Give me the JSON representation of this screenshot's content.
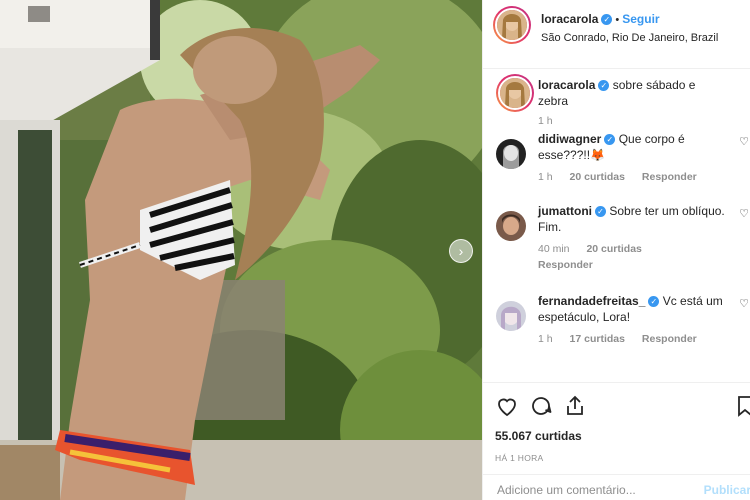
{
  "post": {
    "author": "loracarola",
    "follow_label": "Seguir",
    "location": "São Conrado, Rio De Janeiro, Brazil",
    "caption": "sobre sábado e zebra",
    "caption_time": "1 h"
  },
  "comments": [
    {
      "user": "didiwagner",
      "verified": true,
      "text": "Que corpo é esse???!!🦊",
      "time": "1 h",
      "likes": "20 curtidas",
      "reply": "Responder"
    },
    {
      "user": "jumattoni",
      "verified": true,
      "text": "Sobre ter um oblíquo. Fim.",
      "time": "40 min",
      "likes": "20 curtidas",
      "reply": "Responder"
    },
    {
      "user": "fernandadefreitas_",
      "verified": true,
      "text": "Vc está um espetáculo, Lora!",
      "time": "1 h",
      "likes": "17 curtidas",
      "reply": "Responder"
    }
  ],
  "likes": "55.067 curtidas",
  "posted_time": "HÁ 1 HORA",
  "add_comment": {
    "placeholder": "Adicione um comentário...",
    "publish_label": "Publicar"
  },
  "icons": {
    "like": "heart-icon",
    "comment": "comment-icon",
    "share": "share-icon",
    "save": "bookmark-icon",
    "next": "chevron-right-icon"
  },
  "colors": {
    "link_blue": "#3897f0",
    "verified_blue": "#3897f0",
    "muted": "#8e8e8e",
    "border": "#efefef"
  }
}
